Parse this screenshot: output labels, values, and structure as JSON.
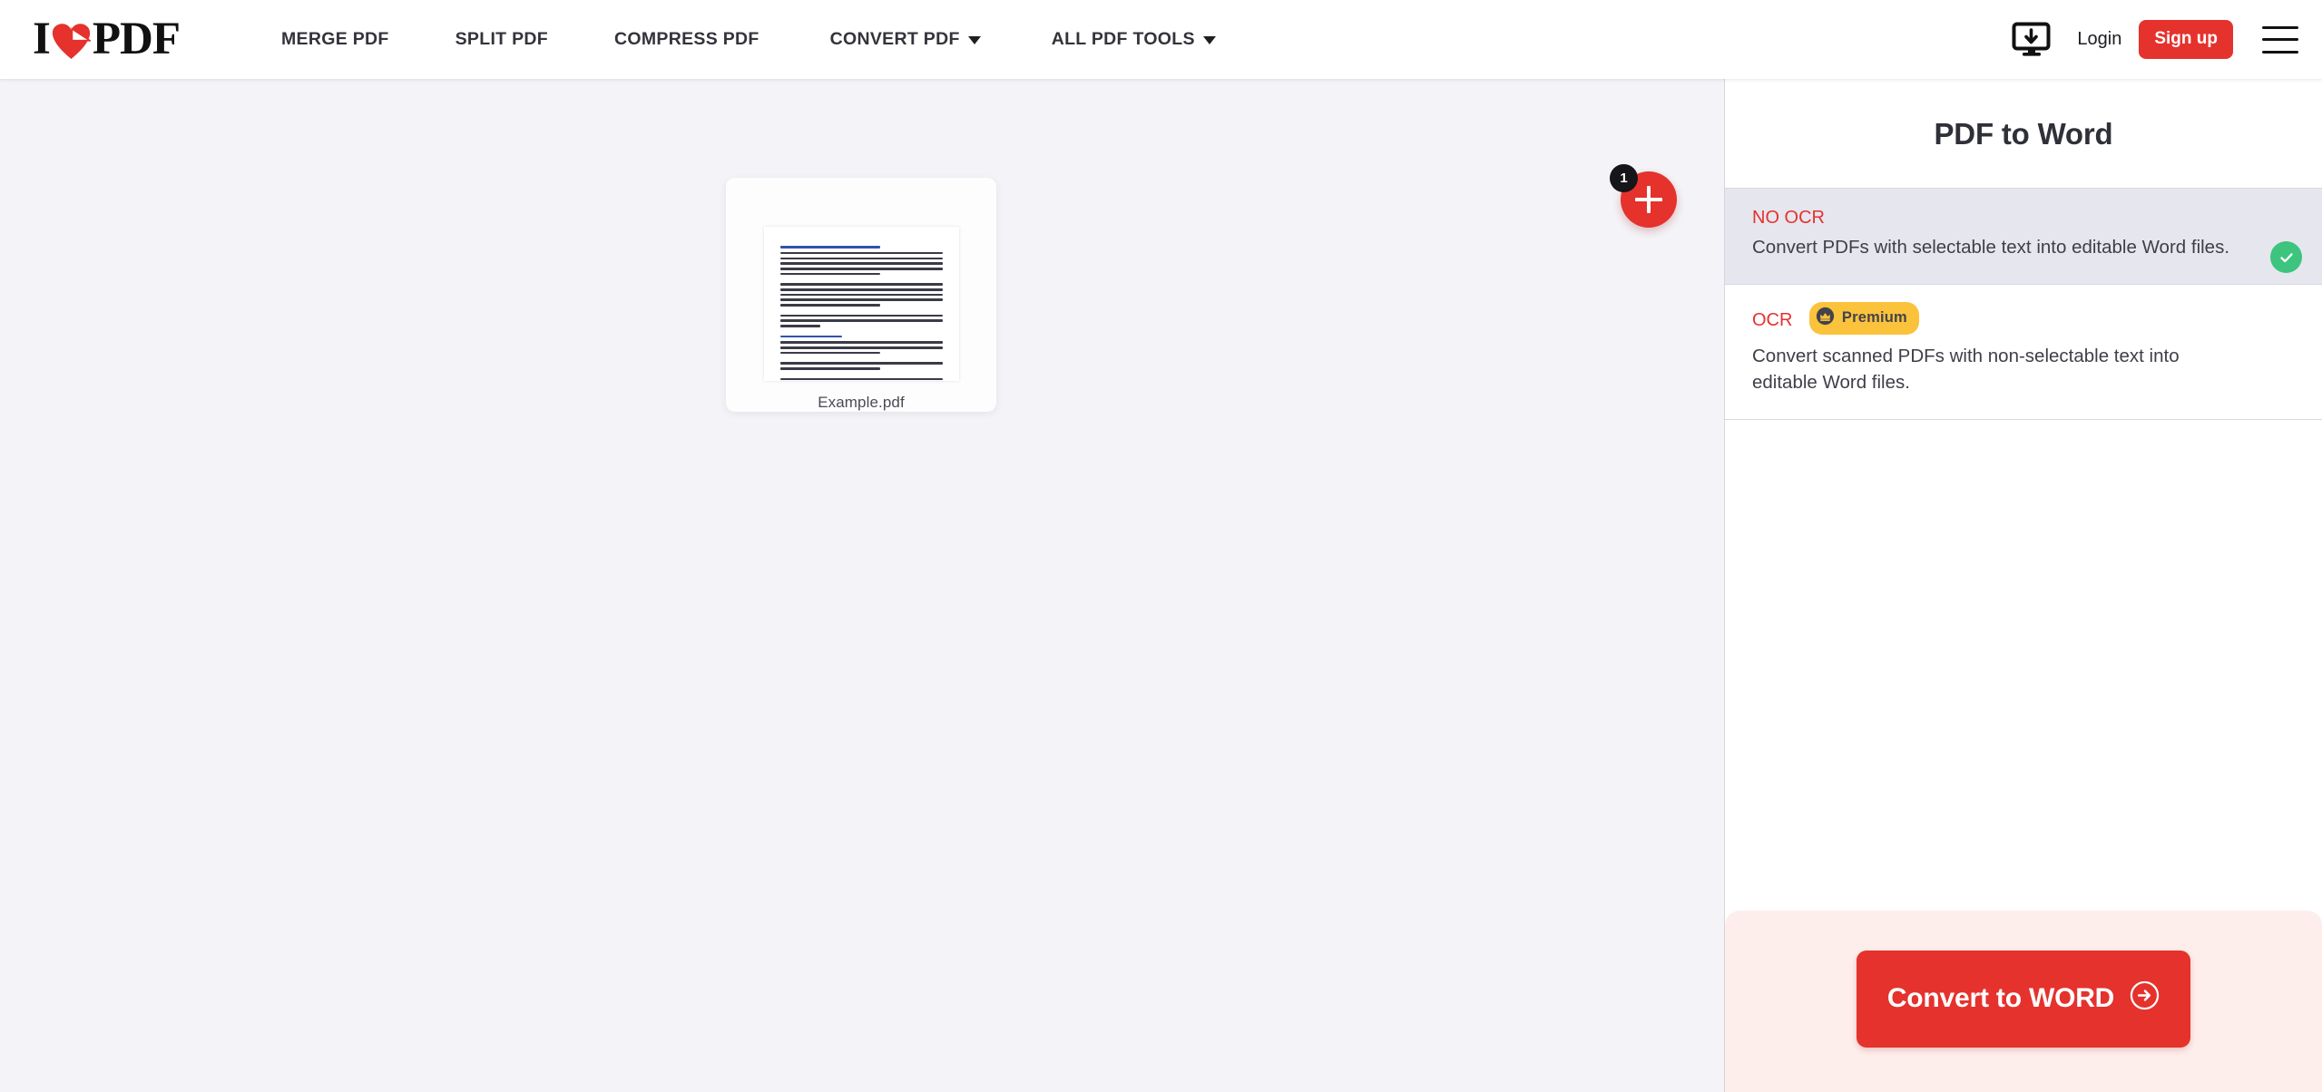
{
  "header": {
    "logo": {
      "prefix": "I",
      "suffix": "PDF",
      "heart_icon": "heart-icon",
      "color": "#e5322d"
    },
    "nav": [
      {
        "label": "MERGE PDF",
        "has_caret": false
      },
      {
        "label": "SPLIT PDF",
        "has_caret": false
      },
      {
        "label": "COMPRESS PDF",
        "has_caret": false
      },
      {
        "label": "CONVERT PDF",
        "has_caret": true
      },
      {
        "label": "ALL PDF TOOLS",
        "has_caret": true
      }
    ],
    "desktop_download_icon": "desktop-download-icon",
    "login_label": "Login",
    "signup_label": "Sign up",
    "menu_icon": "hamburger-menu-icon"
  },
  "workspace": {
    "file": {
      "name": "Example.pdf",
      "thumbnail_alt": "pdf-page-thumbnail"
    },
    "add_file": {
      "icon": "plus-icon",
      "badge_count": "1"
    }
  },
  "sidebar": {
    "title": "PDF to Word",
    "options": [
      {
        "label": "NO OCR",
        "description": "Convert PDFs with selectable text into editable Word files.",
        "selected": true,
        "premium": false,
        "check_icon": "check-icon"
      },
      {
        "label": "OCR",
        "description": "Convert scanned PDFs with non-selectable text into editable Word files.",
        "selected": false,
        "premium": true,
        "premium_label": "Premium",
        "premium_icon": "crown-icon"
      }
    ],
    "action": {
      "label": "Convert to WORD",
      "icon": "arrow-right-circle-icon"
    }
  },
  "colors": {
    "brand_red": "#e5322d",
    "premium_yellow": "#fbc23c",
    "success_green": "#3dc47f",
    "canvas_bg": "#f4f4f8",
    "selected_bg": "#e6e6ef"
  }
}
